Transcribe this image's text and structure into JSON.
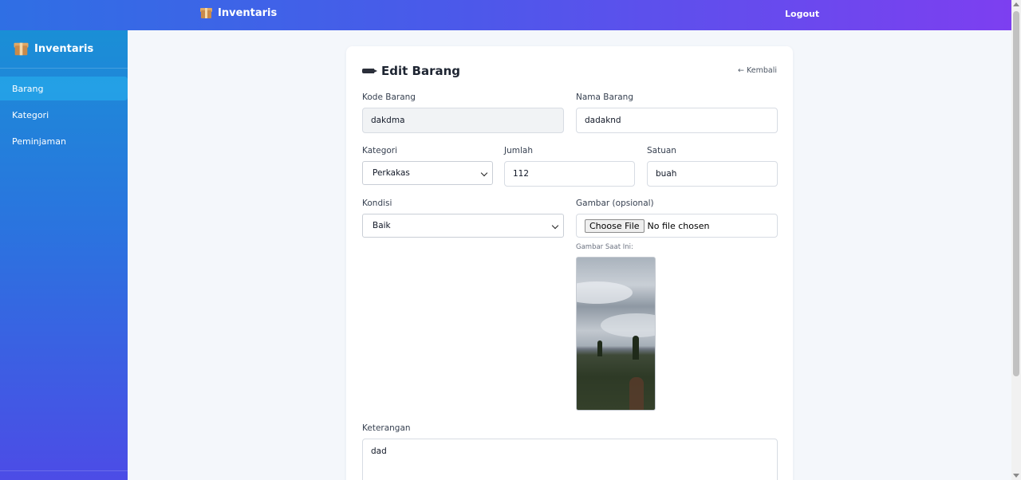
{
  "topbar": {
    "brand": "Inventaris",
    "logout_label": "Logout"
  },
  "sidebar": {
    "brand": "Inventaris",
    "items": [
      {
        "label": "Barang",
        "active": true
      },
      {
        "label": "Kategori",
        "active": false
      },
      {
        "label": "Peminjaman",
        "active": false
      }
    ]
  },
  "form": {
    "title": "Edit Barang",
    "back_label": "← Kembali",
    "kode": {
      "label": "Kode Barang",
      "value": "dakdma"
    },
    "nama": {
      "label": "Nama Barang",
      "value": "dadaknd"
    },
    "kategori": {
      "label": "Kategori",
      "value": "Perkakas"
    },
    "jumlah": {
      "label": "Jumlah",
      "value": "112"
    },
    "satuan": {
      "label": "Satuan",
      "value": "buah"
    },
    "kondisi": {
      "label": "Kondisi",
      "value": "Baik"
    },
    "gambar": {
      "label": "Gambar (opsional)",
      "button_label": "Choose File",
      "status": "No file chosen",
      "current_label": "Gambar Saat Ini:"
    },
    "keterangan": {
      "label": "Keterangan",
      "value": "dad"
    }
  },
  "colors": {
    "topbar_start": "#2f6fe4",
    "topbar_end": "#7d3ff0",
    "sidebar_start": "#1a8fd6",
    "sidebar_end": "#4c4ce6"
  },
  "icons": [
    "box-icon",
    "pen-icon",
    "chevron-down-icon"
  ]
}
